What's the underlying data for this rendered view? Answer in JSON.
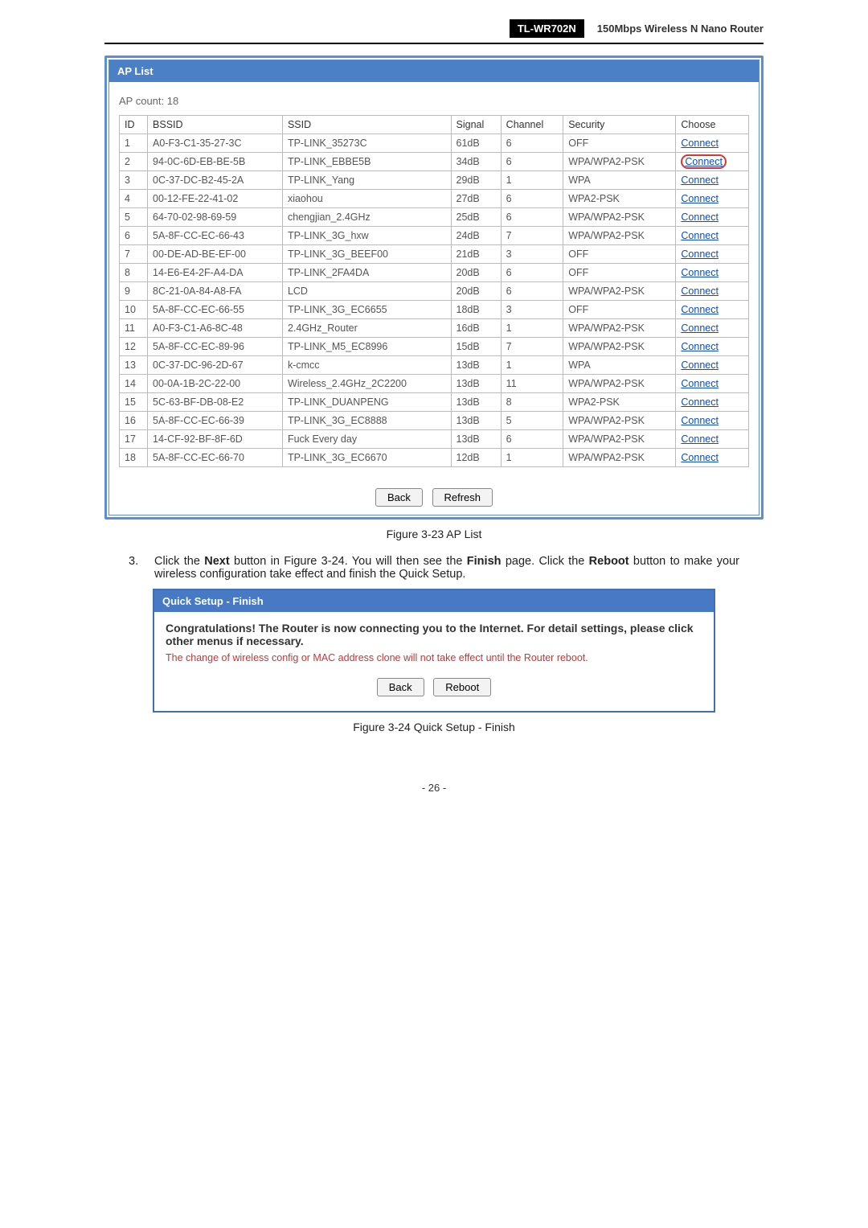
{
  "header": {
    "model": "TL-WR702N",
    "title": "150Mbps  Wireless  N  Nano  Router"
  },
  "apList": {
    "barTitle": "AP List",
    "countLabel": "AP count:  18",
    "cols": [
      "ID",
      "BSSID",
      "SSID",
      "Signal",
      "Channel",
      "Security",
      "Choose"
    ],
    "rows": [
      {
        "id": "1",
        "bssid": "A0-F3-C1-35-27-3C",
        "ssid": "TP-LINK_35273C",
        "sig": "61dB",
        "ch": "6",
        "sec": "OFF",
        "choose": "Connect",
        "circled": false
      },
      {
        "id": "2",
        "bssid": "94-0C-6D-EB-BE-5B",
        "ssid": "TP-LINK_EBBE5B",
        "sig": "34dB",
        "ch": "6",
        "sec": "WPA/WPA2-PSK",
        "choose": "Connect",
        "circled": true
      },
      {
        "id": "3",
        "bssid": "0C-37-DC-B2-45-2A",
        "ssid": "TP-LINK_Yang",
        "sig": "29dB",
        "ch": "1",
        "sec": "WPA",
        "choose": "Connect",
        "circled": false
      },
      {
        "id": "4",
        "bssid": "00-12-FE-22-41-02",
        "ssid": "xiaohou",
        "sig": "27dB",
        "ch": "6",
        "sec": "WPA2-PSK",
        "choose": "Connect",
        "circled": false
      },
      {
        "id": "5",
        "bssid": "64-70-02-98-69-59",
        "ssid": "chengjian_2.4GHz",
        "sig": "25dB",
        "ch": "6",
        "sec": "WPA/WPA2-PSK",
        "choose": "Connect",
        "circled": false
      },
      {
        "id": "6",
        "bssid": "5A-8F-CC-EC-66-43",
        "ssid": "TP-LINK_3G_hxw",
        "sig": "24dB",
        "ch": "7",
        "sec": "WPA/WPA2-PSK",
        "choose": "Connect",
        "circled": false
      },
      {
        "id": "7",
        "bssid": "00-DE-AD-BE-EF-00",
        "ssid": "TP-LINK_3G_BEEF00",
        "sig": "21dB",
        "ch": "3",
        "sec": "OFF",
        "choose": "Connect",
        "circled": false
      },
      {
        "id": "8",
        "bssid": "14-E6-E4-2F-A4-DA",
        "ssid": "TP-LINK_2FA4DA",
        "sig": "20dB",
        "ch": "6",
        "sec": "OFF",
        "choose": "Connect",
        "circled": false
      },
      {
        "id": "9",
        "bssid": "8C-21-0A-84-A8-FA",
        "ssid": "LCD",
        "sig": "20dB",
        "ch": "6",
        "sec": "WPA/WPA2-PSK",
        "choose": "Connect",
        "circled": false
      },
      {
        "id": "10",
        "bssid": "5A-8F-CC-EC-66-55",
        "ssid": "TP-LINK_3G_EC6655",
        "sig": "18dB",
        "ch": "3",
        "sec": "OFF",
        "choose": "Connect",
        "circled": false
      },
      {
        "id": "11",
        "bssid": "A0-F3-C1-A6-8C-48",
        "ssid": "2.4GHz_Router",
        "sig": "16dB",
        "ch": "1",
        "sec": "WPA/WPA2-PSK",
        "choose": "Connect",
        "circled": false
      },
      {
        "id": "12",
        "bssid": "5A-8F-CC-EC-89-96",
        "ssid": "TP-LINK_M5_EC8996",
        "sig": "15dB",
        "ch": "7",
        "sec": "WPA/WPA2-PSK",
        "choose": "Connect",
        "circled": false
      },
      {
        "id": "13",
        "bssid": "0C-37-DC-96-2D-67",
        "ssid": "k-cmcc",
        "sig": "13dB",
        "ch": "1",
        "sec": "WPA",
        "choose": "Connect",
        "circled": false
      },
      {
        "id": "14",
        "bssid": "00-0A-1B-2C-22-00",
        "ssid": "Wireless_2.4GHz_2C2200",
        "sig": "13dB",
        "ch": "11",
        "sec": "WPA/WPA2-PSK",
        "choose": "Connect",
        "circled": false
      },
      {
        "id": "15",
        "bssid": "5C-63-BF-DB-08-E2",
        "ssid": "TP-LINK_DUANPENG",
        "sig": "13dB",
        "ch": "8",
        "sec": "WPA2-PSK",
        "choose": "Connect",
        "circled": false
      },
      {
        "id": "16",
        "bssid": "5A-8F-CC-EC-66-39",
        "ssid": "TP-LINK_3G_EC8888",
        "sig": "13dB",
        "ch": "5",
        "sec": "WPA/WPA2-PSK",
        "choose": "Connect",
        "circled": false
      },
      {
        "id": "17",
        "bssid": "14-CF-92-BF-8F-6D",
        "ssid": "Fuck Every day",
        "sig": "13dB",
        "ch": "6",
        "sec": "WPA/WPA2-PSK",
        "choose": "Connect",
        "circled": false
      },
      {
        "id": "18",
        "bssid": "5A-8F-CC-EC-66-70",
        "ssid": "TP-LINK_3G_EC6670",
        "sig": "12dB",
        "ch": "1",
        "sec": "WPA/WPA2-PSK",
        "choose": "Connect",
        "circled": false
      }
    ],
    "buttons": {
      "back": "Back",
      "refresh": "Refresh"
    },
    "caption": "Figure 3-23 AP List"
  },
  "step": {
    "num": "3.",
    "pre": "Click the ",
    "b1": "Next",
    "mid1": " button in Figure 3-24. You will then see the ",
    "b2": "Finish",
    "mid2": " page. Click the ",
    "b3": "Reboot",
    "post": " button to make your wireless configuration take effect and finish the Quick Setup."
  },
  "finish": {
    "barTitle": "Quick Setup - Finish",
    "cong": "Congratulations! The Router is now connecting you to the Internet. For detail settings, please click other menus if necessary.",
    "warn": "The change of wireless config or MAC address clone will not take effect until the Router reboot.",
    "buttons": {
      "back": "Back",
      "reboot": "Reboot"
    },
    "caption": "Figure 3-24 Quick Setup - Finish"
  },
  "footer": "- 26 -"
}
